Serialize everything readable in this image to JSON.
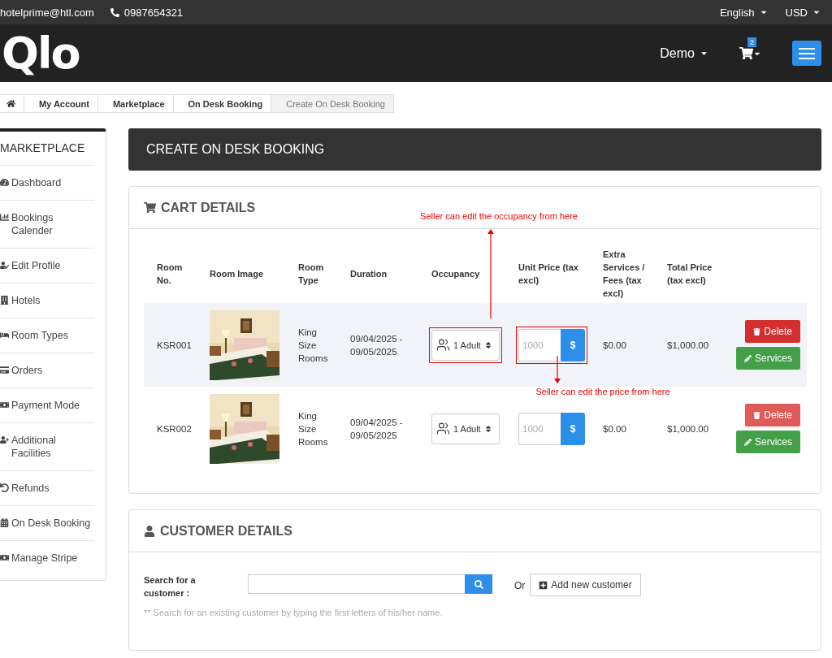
{
  "top_bar": {
    "email": "hotelprime@htl.com",
    "phone": "0987654321",
    "language": "English",
    "currency": "USD"
  },
  "header": {
    "logo": "Qlo",
    "user": "Demo",
    "cart_count": "2"
  },
  "breadcrumb": [
    {
      "label": "My Account",
      "current": false
    },
    {
      "label": "Marketplace",
      "current": false
    },
    {
      "label": "On Desk Booking",
      "current": false
    },
    {
      "label": "Create On Desk Booking",
      "current": true
    }
  ],
  "sidebar": {
    "title": "MARKETPLACE",
    "items": [
      {
        "label": "Dashboard"
      },
      {
        "label": "Bookings Calender"
      },
      {
        "label": "Edit Profile"
      },
      {
        "label": "Hotels"
      },
      {
        "label": "Room Types"
      },
      {
        "label": "Orders"
      },
      {
        "label": "Payment Mode"
      },
      {
        "label": "Additional Facilities"
      },
      {
        "label": "Refunds"
      },
      {
        "label": "On Desk Booking"
      },
      {
        "label": "Manage Stripe"
      }
    ]
  },
  "page_title": "CREATE ON DESK BOOKING",
  "cart": {
    "title": "CART DETAILS",
    "columns": [
      "Room No.",
      "Room Image",
      "Room Type",
      "Duration",
      "Occupancy",
      "Unit Price (tax excl)",
      "Extra Services / Fees (tax excl)",
      "Total Price (tax excl)"
    ],
    "rows": [
      {
        "room_no": "KSR001",
        "room_type": "King Size Rooms",
        "duration": "09/04/2025 - 09/05/2025",
        "occupancy": "1 Adult",
        "occupancy_note": "Seller can edit the occupancy from here",
        "price_placeholder": "1000",
        "price_note": "Seller can edit the price from here",
        "currency": "$",
        "extra": "$0.00",
        "total": "$1,000.00",
        "highlighted": true,
        "delete": "Delete",
        "services": "Services"
      },
      {
        "room_no": "KSR002",
        "room_type": "King Size Rooms",
        "duration": "09/04/2025 - 09/05/2025",
        "occupancy": "1 Adult",
        "price_placeholder": "1000",
        "currency": "$",
        "extra": "$0.00",
        "total": "$1,000.00",
        "highlighted": false,
        "delete": "Delete",
        "services": "Services"
      }
    ]
  },
  "customer": {
    "title": "CUSTOMER DETAILS",
    "search_label": "Search for a customer :",
    "or": "Or",
    "add_button": "Add new customer",
    "hint": "** Search for an existing customer by typing the first letters of his/her name."
  }
}
